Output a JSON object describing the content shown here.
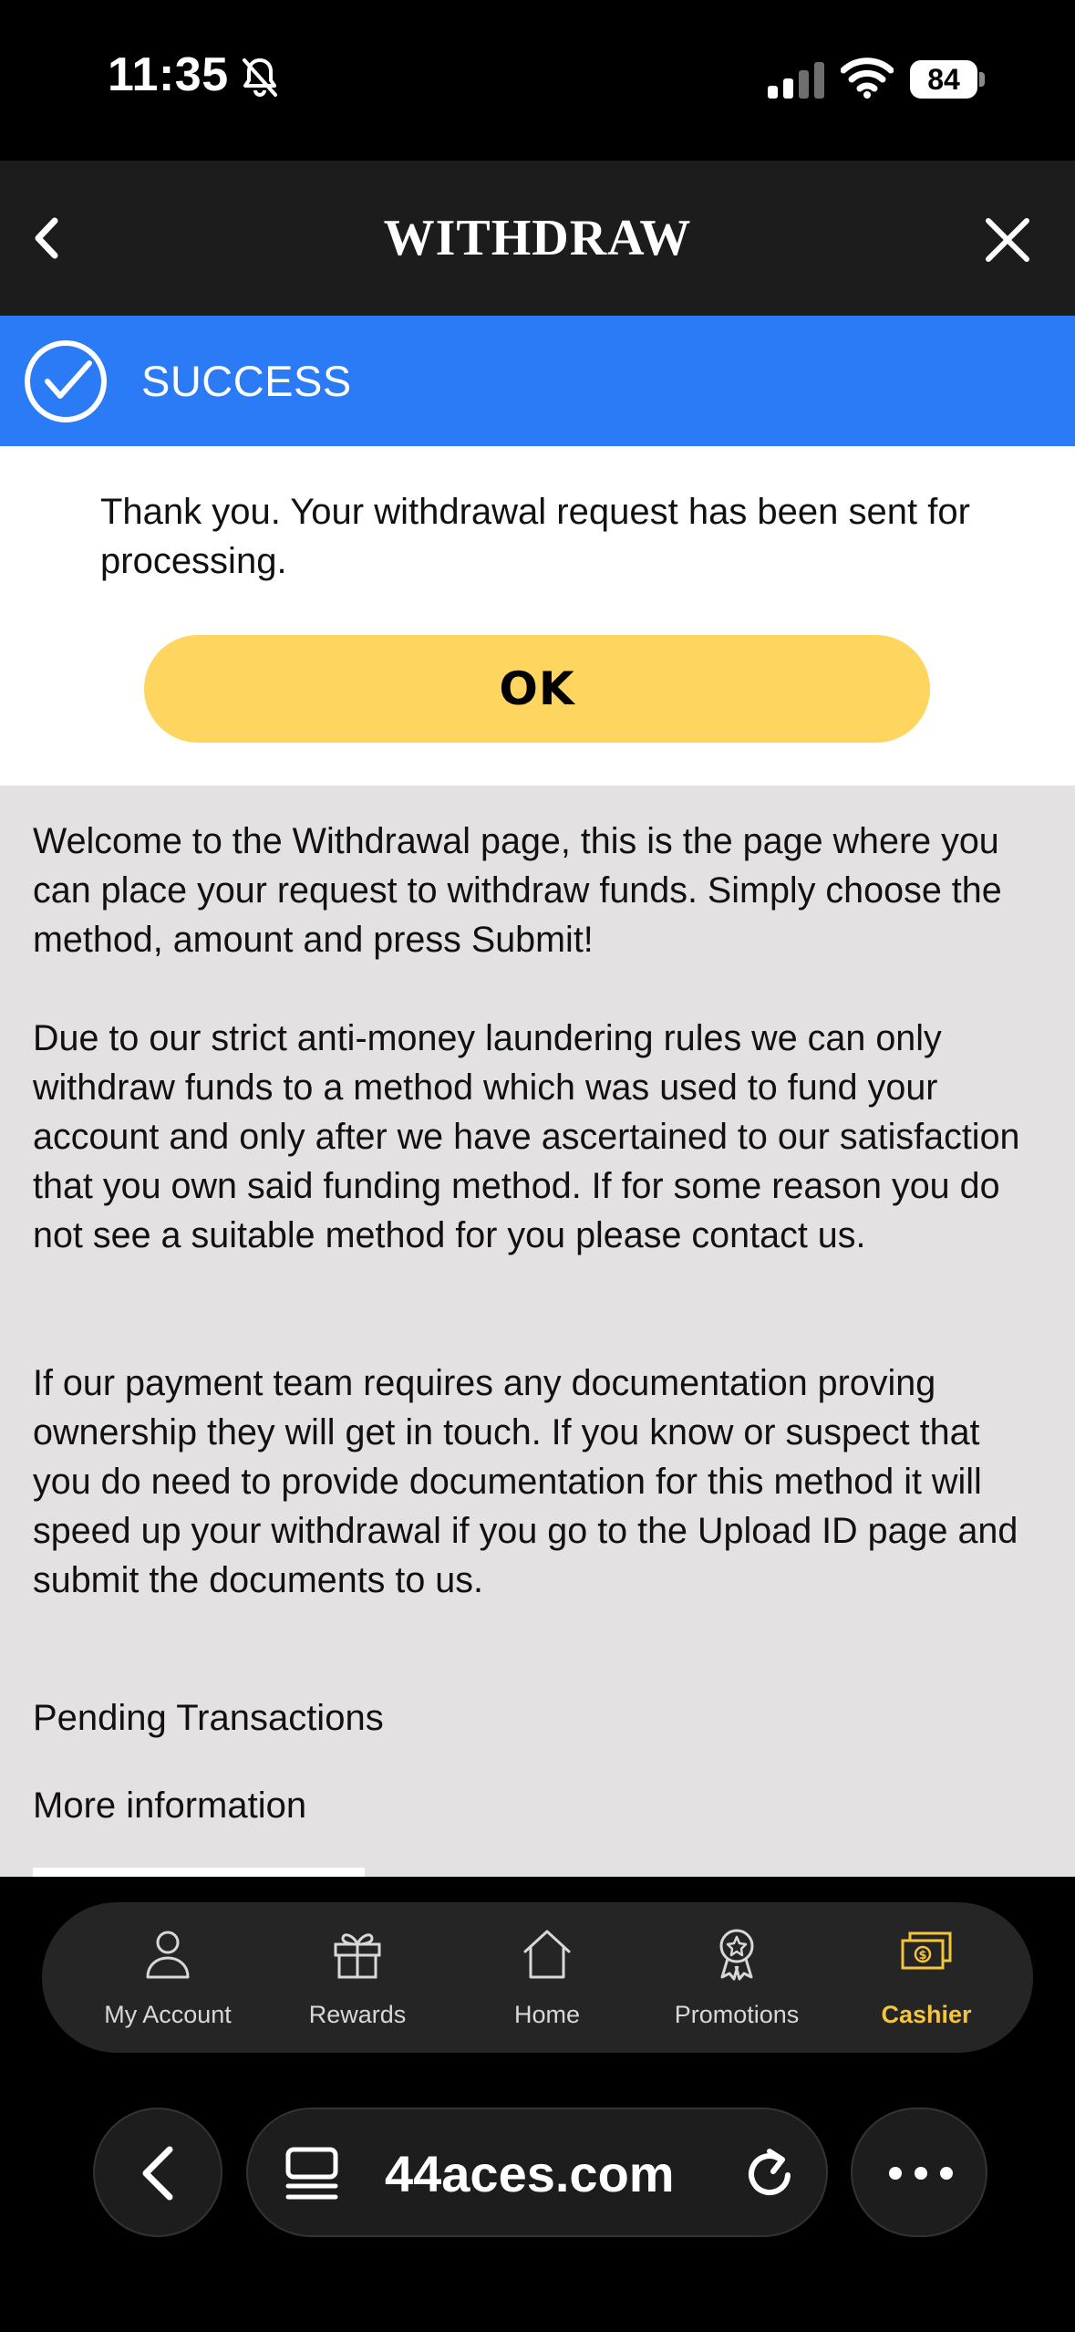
{
  "status_bar": {
    "time": "11:35",
    "battery": "84",
    "icons": [
      "bell-slash-icon",
      "cellular-signal-icon",
      "wifi-icon",
      "battery-icon"
    ]
  },
  "header": {
    "title": "WITHDRAW",
    "back_icon": "chevron-left-icon",
    "close_icon": "close-icon"
  },
  "success_banner": {
    "label": "SUCCESS",
    "icon": "check-circle-icon",
    "color": "#2b7bf6"
  },
  "success_panel": {
    "message": "Thank you. Your withdrawal request has been sent for processing.",
    "ok_label": "OK",
    "button_color": "#fdd55f"
  },
  "content": {
    "paragraphs": [
      "Welcome to the Withdrawal page, this is the page where you can place your request to withdraw funds. Simply choose the method, amount and press Submit!",
      "Due to our strict anti-money laundering rules we can only withdraw funds to a method which was used to fund your account and only after we have ascertained to our satisfaction that you own said funding method. If for some reason you do not see a suitable method for you please contact us.",
      "If our payment team requires any documentation proving ownership they will get in touch. If you know or suspect that you do need to provide documentation for this method it will speed up your withdrawal if you go to the Upload ID page and submit the documents to us."
    ],
    "pending_transactions": "Pending Transactions",
    "more_information": "More information"
  },
  "bottom_nav": {
    "items": [
      {
        "label": "My Account",
        "icon": "user-icon",
        "active": false
      },
      {
        "label": "Rewards",
        "icon": "gift-icon",
        "active": false
      },
      {
        "label": "Home",
        "icon": "home-icon",
        "active": false
      },
      {
        "label": "Promotions",
        "icon": "award-badge-icon",
        "active": false
      },
      {
        "label": "Cashier",
        "icon": "cash-icon",
        "active": true
      }
    ],
    "active_color": "#f4c53a"
  },
  "browser": {
    "url": "44aces.com",
    "icons": [
      "chevron-left-icon",
      "tabs-icon",
      "reload-icon",
      "more-icon"
    ]
  }
}
